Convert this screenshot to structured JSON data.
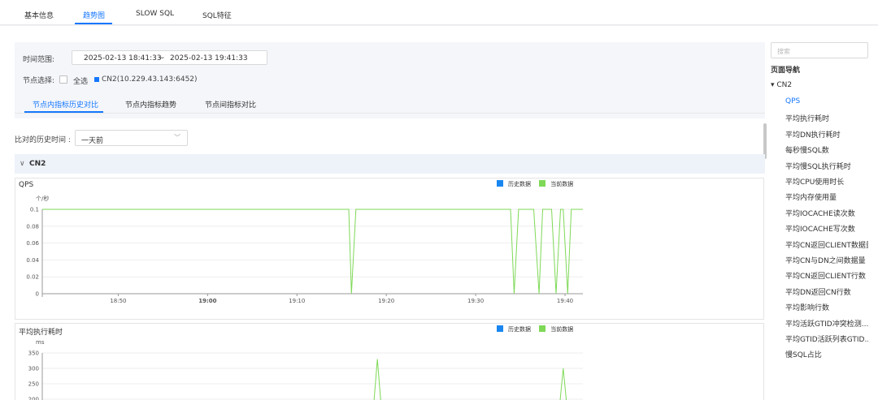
{
  "tabs": [
    "基本信息",
    "趋势图",
    "SLOW SQL",
    "SQL特征"
  ],
  "active_tab": 1,
  "filter": {
    "time_label": "时间范围:",
    "start": "2025-02-13 18:41:33",
    "sep": "~",
    "end": "2025-02-13 19:41:33",
    "node_label": "节点选择:",
    "select_all": "全选",
    "node": "CN2(10.229.43.143:6452)",
    "node_color": "#1677ff"
  },
  "subtabs": [
    "节点内指标历史对比",
    "节点内指标趋势",
    "节点间指标对比"
  ],
  "active_subtab": 0,
  "compare": {
    "label": "比对的历史时间 :",
    "value": "一天前"
  },
  "group": {
    "chevron": "∨",
    "name": "CN2"
  },
  "legend": {
    "history": "历史数据",
    "current": "当前数据",
    "history_color": "#1a86f0",
    "current_color": "#7ed957"
  },
  "chart_data": [
    {
      "type": "line",
      "title": "QPS",
      "ylabel": "个/秒",
      "ylim": [
        0,
        0.1
      ],
      "yticks": [
        "0",
        "0.02",
        "0.04",
        "0.06",
        "0.08",
        "0.1"
      ],
      "xtick_labels": [
        "18:50",
        "19:00",
        "19:10",
        "19:20",
        "19:30",
        "19:40"
      ],
      "xtick_minutes": [
        8.5,
        18.5,
        28.5,
        38.5,
        48.5,
        58.5
      ],
      "xlim_minutes": [
        0,
        60.5
      ],
      "series": [
        {
          "name": "当前数据",
          "color": "#7ed957",
          "x": [
            0,
            34.3,
            34.6,
            35.1,
            52.4,
            52.8,
            53.3,
            55.0,
            55.6,
            56.0,
            57.0,
            57.5,
            58.0,
            58.3,
            58.8,
            59.2,
            60.5
          ],
          "y": [
            0.1,
            0.1,
            0,
            0.1,
            0.1,
            0,
            0.1,
            0.1,
            0,
            0.1,
            0.1,
            0,
            0.1,
            0.1,
            0,
            0.1,
            0.1
          ]
        }
      ]
    },
    {
      "type": "line",
      "title": "平均执行耗时",
      "ylabel": "ms",
      "ylim": [
        150,
        350
      ],
      "yticks": [
        "200",
        "250",
        "300",
        "350"
      ],
      "series": [
        {
          "name": "当前数据",
          "color": "#7ed957",
          "x": [
            37.0,
            37.5,
            38.0,
            57.8,
            58.3,
            58.8
          ],
          "y": [
            150,
            330,
            150,
            150,
            300,
            150
          ]
        }
      ]
    }
  ],
  "nav": {
    "search_placeholder": "搜索",
    "title": "页面导航",
    "group": "▾ CN2",
    "items": [
      "QPS",
      "平均执行耗时",
      "平均DN执行耗时",
      "每秒慢SQL数",
      "平均慢SQL执行耗时",
      "平均CPU使用时长",
      "平均内存使用量",
      "平均IOCACHE读次数",
      "平均IOCACHE写次数",
      "平均CN返回CLIENT数据量",
      "平均CN与DN之间数据量",
      "平均CN返回CLIENT行数",
      "平均DN返回CN行数",
      "平均影响行数",
      "平均活跃GTID冲突检测...",
      "平均GTID活跃列表GTID...",
      "慢SQL占比"
    ],
    "active": 0
  }
}
